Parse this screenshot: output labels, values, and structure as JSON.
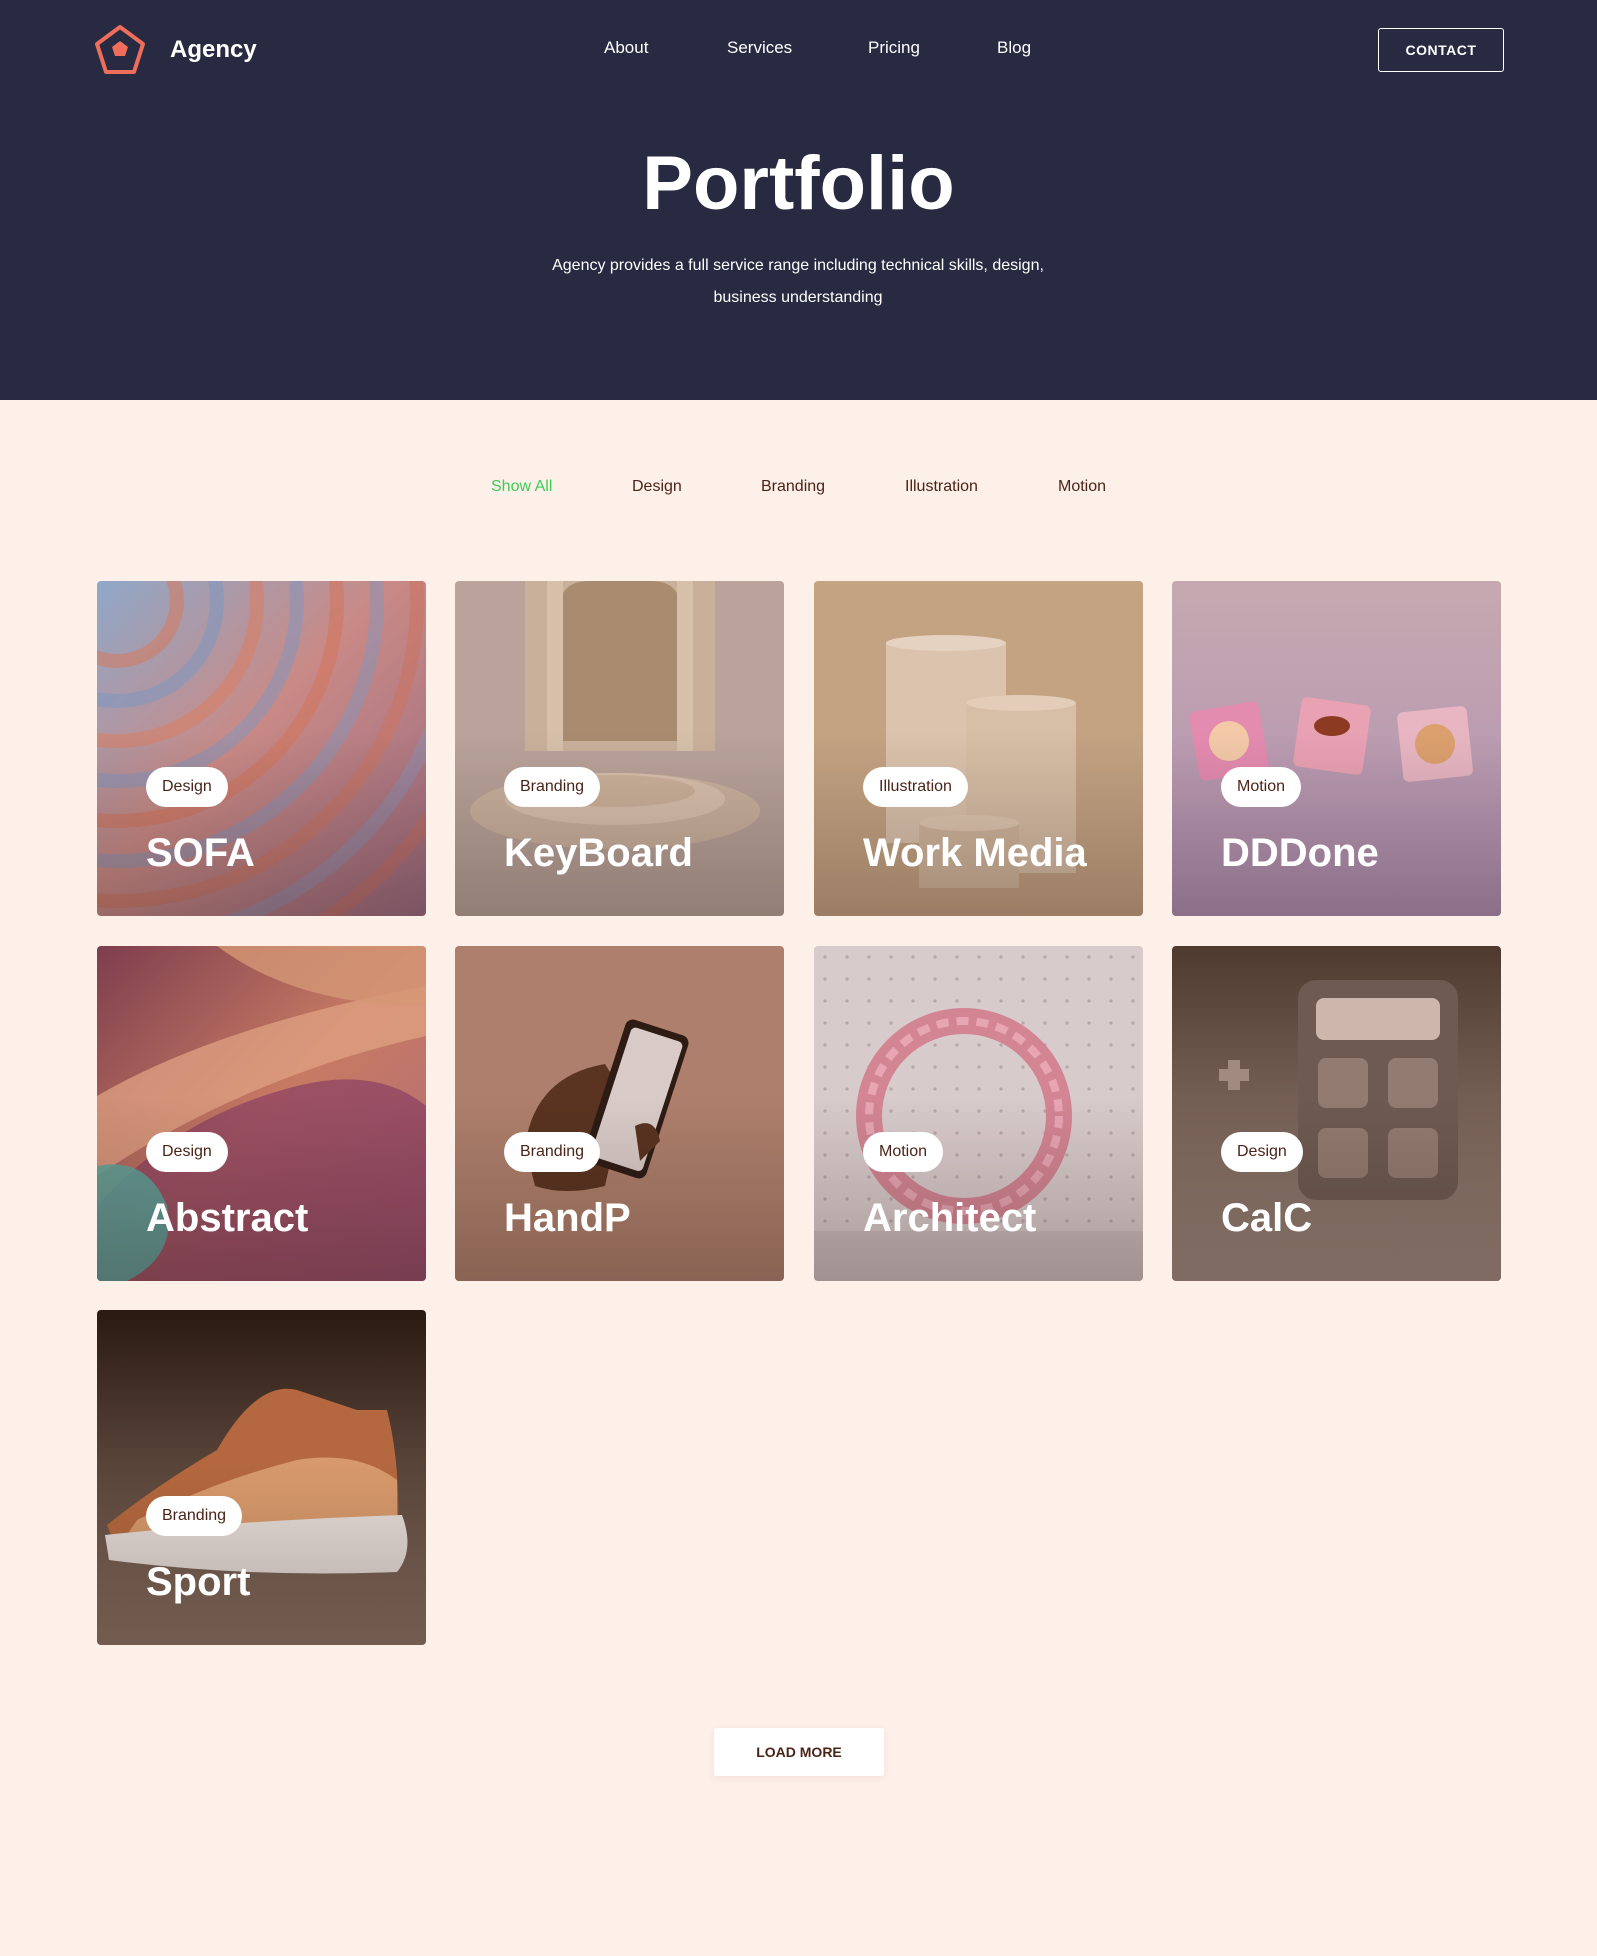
{
  "header": {
    "brand": "Agency",
    "nav": [
      "About",
      "Services",
      "Pricing",
      "Blog"
    ],
    "contact_label": "CONTACT",
    "accent": "#ee6e5b"
  },
  "hero": {
    "title": "Portfolio",
    "subtitle": "Agency provides a full service range including technical skills, design, business understanding"
  },
  "filters": {
    "items": [
      "Show All",
      "Design",
      "Branding",
      "Illustration",
      "Motion"
    ],
    "active": "Show All",
    "active_color": "#3ecb5a"
  },
  "projects": [
    {
      "title": "SOFA",
      "category": "Design"
    },
    {
      "title": "KeyBoard",
      "category": "Branding"
    },
    {
      "title": "Work Media",
      "category": "Illustration"
    },
    {
      "title": "DDDone",
      "category": "Motion"
    },
    {
      "title": "Abstract",
      "category": "Design"
    },
    {
      "title": "HandP",
      "category": "Branding"
    },
    {
      "title": "Architect",
      "category": "Motion"
    },
    {
      "title": "CalC",
      "category": "Design"
    },
    {
      "title": "Sport",
      "category": "Branding"
    }
  ],
  "load_more_label": "LOAD MORE"
}
